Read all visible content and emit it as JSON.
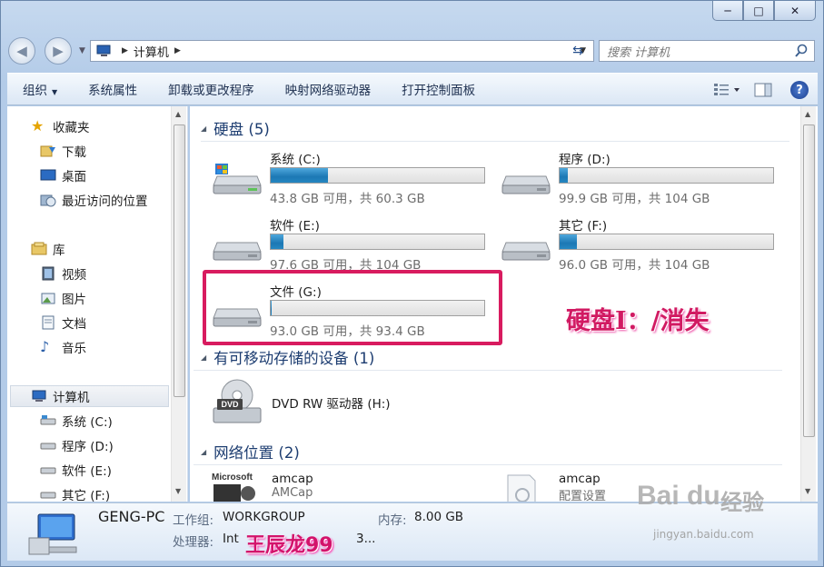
{
  "window": {
    "caption_min": "─",
    "caption_max": "□",
    "caption_close": "✕"
  },
  "address": {
    "crumb": "计算机",
    "search_placeholder": "搜索 计算机"
  },
  "toolbar": {
    "organize": "组织",
    "system_properties": "系统属性",
    "uninstall": "卸载或更改程序",
    "map_drive": "映射网络驱动器",
    "control_panel": "打开控制面板",
    "help": "?"
  },
  "nav": {
    "favorites": "收藏夹",
    "downloads": "下载",
    "desktop": "桌面",
    "recent": "最近访问的位置",
    "libraries": "库",
    "videos": "视频",
    "pictures": "图片",
    "documents": "文档",
    "music": "音乐",
    "computer": "计算机",
    "drive_c": "系统 (C:)",
    "drive_d": "程序 (D:)",
    "drive_e": "软件 (E:)",
    "drive_f": "其它 (F:)"
  },
  "groups": {
    "hdd": "硬盘 (5)",
    "removable": "有可移动存储的设备 (1)",
    "network": "网络位置 (2)"
  },
  "drives": [
    {
      "name": "系统 (C:)",
      "info": "43.8 GB 可用，共 60.3 GB",
      "used": 0.27
    },
    {
      "name": "程序 (D:)",
      "info": "99.9 GB 可用，共 104 GB",
      "used": 0.04
    },
    {
      "name": "软件 (E:)",
      "info": "97.6 GB 可用，共 104 GB",
      "used": 0.06
    },
    {
      "name": "其它 (F:)",
      "info": "96.0 GB 可用，共 104 GB",
      "used": 0.08
    },
    {
      "name": "文件 (G:)",
      "info": "93.0 GB 可用，共 93.4 GB",
      "used": 0.004
    }
  ],
  "dvd": {
    "name": "DVD RW 驱动器 (H:)",
    "label": "DVD"
  },
  "network": [
    {
      "name": "amcap",
      "sub": "AMCap",
      "logo": "Microsoft"
    },
    {
      "name": "amcap",
      "sub": "配置设置"
    }
  ],
  "annotation": "硬盘I：/消失",
  "details": {
    "pc_name": "GENG-PC",
    "workgroup_label": "工作组:",
    "workgroup_value": "WORKGROUP",
    "memory_label": "内存:",
    "memory_value": "8.00 GB",
    "cpu_label": "处理器:",
    "cpu_value": "Int",
    "cpu_tail": "3...",
    "signature": "王辰龙99"
  },
  "watermark": {
    "logo": "Bai du",
    "cn": "经验",
    "url": "jingyan.baidu.com"
  }
}
